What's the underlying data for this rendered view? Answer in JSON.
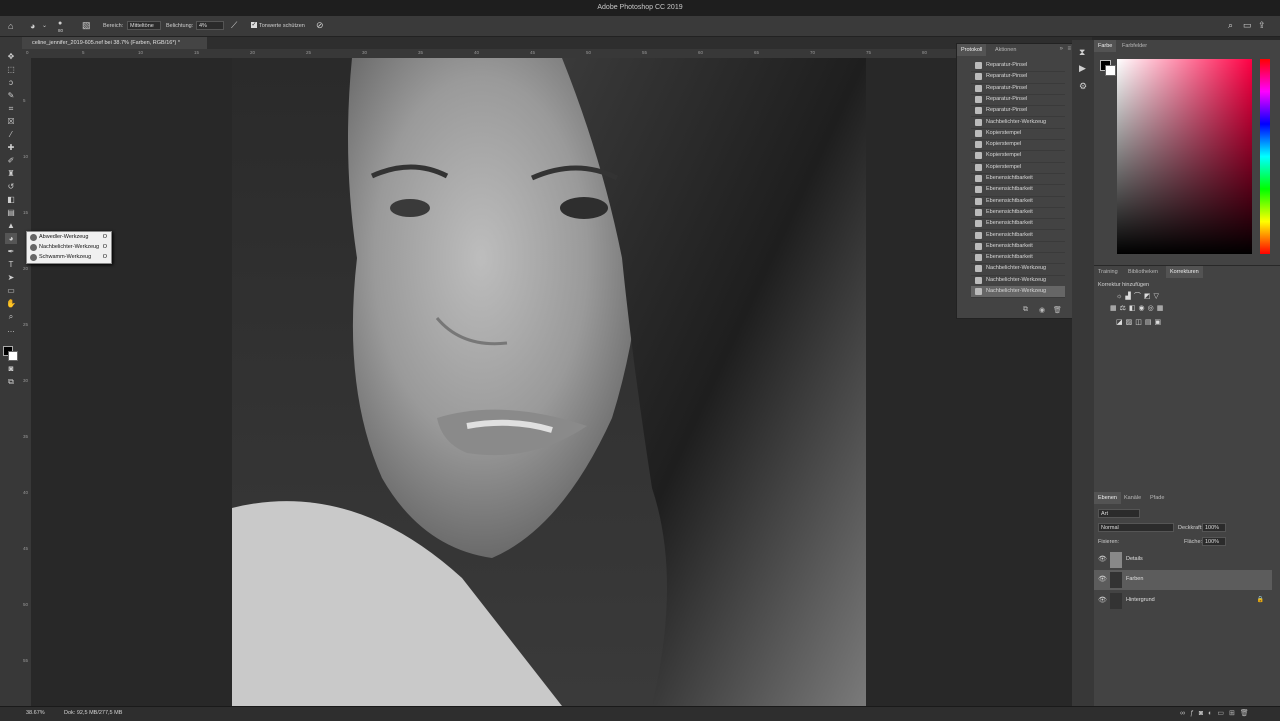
{
  "window": {
    "title": "Adobe Photoshop CC 2019"
  },
  "options_bar": {
    "brush_size": "80",
    "range_label": "Bereich:",
    "range_value": "Mitteltöne",
    "exposure_label": "Belichtung:",
    "exposure_value": "4%",
    "protect_tones_label": "Tonwerte schützen"
  },
  "document": {
    "tab_title": "celine_jennifer_2019-605.nef bei 38.7% (Farben, RGB/16*) *",
    "zoom": "38.67%",
    "doc_size": "Dok: 92,5 MB/277,5 MB"
  },
  "ruler": {
    "top_labels": [
      "0",
      "5",
      "10",
      "15",
      "20",
      "25",
      "30",
      "35",
      "40",
      "45",
      "50",
      "55",
      "60",
      "65",
      "70",
      "75",
      "80",
      "85",
      "90"
    ],
    "left_labels": [
      "5",
      "10",
      "15",
      "20",
      "25",
      "30",
      "35",
      "40",
      "45",
      "50",
      "55"
    ]
  },
  "tool_flyout": {
    "items": [
      {
        "label": "Abwedler-Werkzeug",
        "key": "O"
      },
      {
        "label": "Nachbelichter-Werkzeug",
        "key": "O"
      },
      {
        "label": "Schwamm-Werkzeug",
        "key": "O"
      }
    ]
  },
  "history_panel": {
    "tabs": [
      "Protokoll",
      "Aktionen"
    ],
    "items": [
      {
        "label": "Reparatur-Pinsel",
        "icon": "healing-brush-icon"
      },
      {
        "label": "Reparatur-Pinsel",
        "icon": "healing-brush-icon"
      },
      {
        "label": "Reparatur-Pinsel",
        "icon": "healing-brush-icon"
      },
      {
        "label": "Reparatur-Pinsel",
        "icon": "healing-brush-icon"
      },
      {
        "label": "Reparatur-Pinsel",
        "icon": "healing-brush-icon"
      },
      {
        "label": "Nachbelichter-Werkzeug",
        "icon": "burn-tool-icon"
      },
      {
        "label": "Kopierstempel",
        "icon": "clone-stamp-icon"
      },
      {
        "label": "Kopierstempel",
        "icon": "clone-stamp-icon"
      },
      {
        "label": "Kopierstempel",
        "icon": "clone-stamp-icon"
      },
      {
        "label": "Kopierstempel",
        "icon": "clone-stamp-icon"
      },
      {
        "label": "Ebenensichtbarkeit",
        "icon": "layer-visibility-icon"
      },
      {
        "label": "Ebenensichtbarkeit",
        "icon": "layer-visibility-icon"
      },
      {
        "label": "Ebenensichtbarkeit",
        "icon": "layer-visibility-icon"
      },
      {
        "label": "Ebenensichtbarkeit",
        "icon": "layer-visibility-icon"
      },
      {
        "label": "Ebenensichtbarkeit",
        "icon": "layer-visibility-icon"
      },
      {
        "label": "Ebenensichtbarkeit",
        "icon": "layer-visibility-icon"
      },
      {
        "label": "Ebenensichtbarkeit",
        "icon": "layer-visibility-icon"
      },
      {
        "label": "Ebenensichtbarkeit",
        "icon": "layer-visibility-icon"
      },
      {
        "label": "Nachbelichter-Werkzeug",
        "icon": "burn-tool-icon"
      },
      {
        "label": "Nachbelichter-Werkzeug",
        "icon": "burn-tool-icon"
      },
      {
        "label": "Nachbelichter-Werkzeug",
        "icon": "burn-tool-icon"
      }
    ],
    "selected_index": 20
  },
  "color_panel": {
    "tabs": [
      "Farbe",
      "Farbfelder"
    ],
    "foreground": "#000000",
    "background": "#ffffff"
  },
  "adjustments_panel": {
    "tabs": [
      "Training",
      "Bibliotheken",
      "Korrekturen"
    ],
    "hint": "Korrektur hinzufügen"
  },
  "layers_panel": {
    "tabs": [
      "Ebenen",
      "Kanäle",
      "Pfade"
    ],
    "filter_label": "Art",
    "blend_mode": "Normal",
    "opacity_label": "Deckkraft:",
    "opacity_value": "100%",
    "lock_label": "Fixieren:",
    "fill_label": "Fläche:",
    "fill_value": "100%",
    "layers": [
      {
        "name": "Details",
        "selected": false
      },
      {
        "name": "Farben",
        "selected": true
      },
      {
        "name": "Hintergrund",
        "selected": false
      }
    ]
  }
}
